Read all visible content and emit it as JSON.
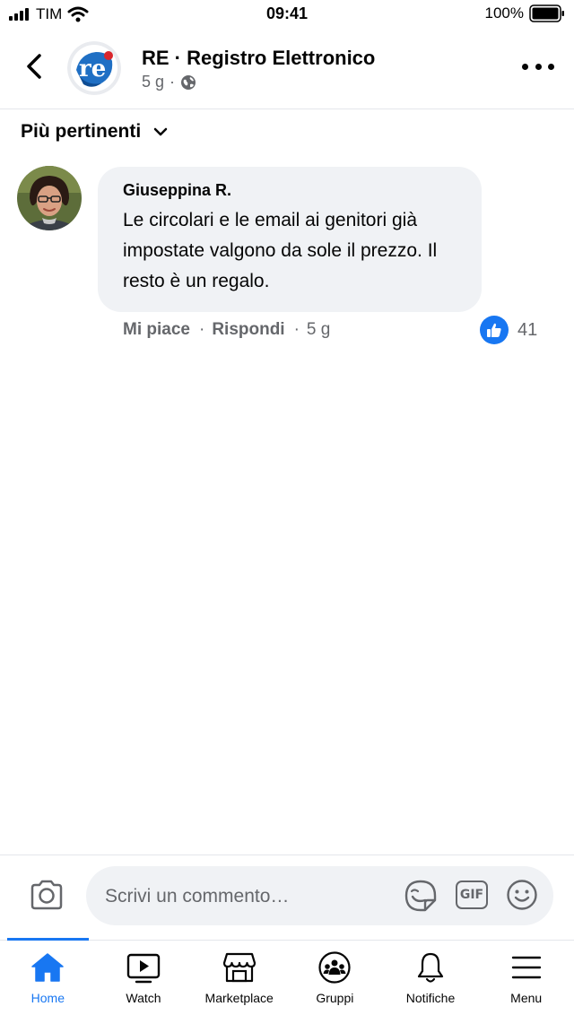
{
  "status_bar": {
    "carrier": "TIM",
    "time": "09:41",
    "battery": "100%"
  },
  "header": {
    "page_name": "RE · Registro Elettronico",
    "post_age": "5 g",
    "logo_text": "re"
  },
  "sort": {
    "label": "Più pertinenti"
  },
  "comment": {
    "author": "Giuseppina R.",
    "text": "Le circolari e le email ai genitori già impostate valgono da sole il prezzo. Il resto è un regalo.",
    "like_label": "Mi piace",
    "reply_label": "Rispondi",
    "age": "5 g",
    "reaction_count": "41"
  },
  "composer": {
    "placeholder": "Scrivi un commento…",
    "gif_label": "GIF"
  },
  "tabs": [
    {
      "label": "Home",
      "icon": "home-icon",
      "active": true
    },
    {
      "label": "Watch",
      "icon": "watch-icon",
      "active": false
    },
    {
      "label": "Marketplace",
      "icon": "marketplace-icon",
      "active": false
    },
    {
      "label": "Gruppi",
      "icon": "groups-icon",
      "active": false
    },
    {
      "label": "Notifiche",
      "icon": "bell-icon",
      "active": false
    },
    {
      "label": "Menu",
      "icon": "menu-icon",
      "active": false
    }
  ],
  "colors": {
    "accent": "#1877f2",
    "secondary_text": "#65676b",
    "bubble": "#f0f2f5"
  }
}
